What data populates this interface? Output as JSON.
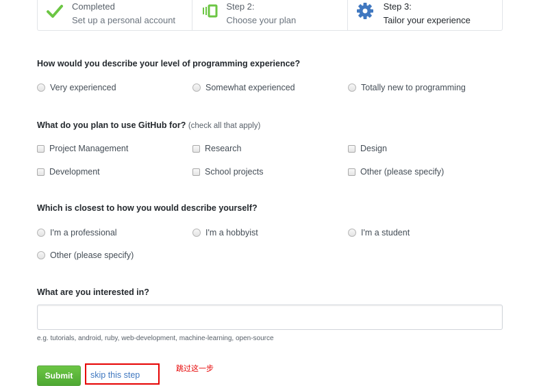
{
  "steps": [
    {
      "title": "Completed",
      "subtitle": "Set up a personal account",
      "icon": "check-icon"
    },
    {
      "title": "Step 2:",
      "subtitle": "Choose your plan",
      "icon": "plan-icon"
    },
    {
      "title": "Step 3:",
      "subtitle": "Tailor your experience",
      "icon": "gear-icon"
    }
  ],
  "experience": {
    "question": "How would you describe your level of programming experience?",
    "options": [
      "Very experienced",
      "Somewhat experienced",
      "Totally new to programming"
    ]
  },
  "usage": {
    "question": "What do you plan to use GitHub for?",
    "hint": "(check all that apply)",
    "options": [
      "Project Management",
      "Research",
      "Design",
      "Development",
      "School projects",
      "Other (please specify)"
    ]
  },
  "describe": {
    "question": "Which is closest to how you would describe yourself?",
    "options": [
      "I'm a professional",
      "I'm a hobbyist",
      "I'm a student",
      "Other (please specify)"
    ]
  },
  "interests": {
    "question": "What are you interested in?",
    "value": "",
    "note": "e.g. tutorials, android, ruby, web-development, machine-learning, open-source"
  },
  "actions": {
    "submit": "Submit",
    "skip": "skip this step",
    "annotation": "跳过这一步"
  },
  "colors": {
    "green": "#6cc644",
    "blue": "#4078c0",
    "annotation_red": "#e60000"
  }
}
